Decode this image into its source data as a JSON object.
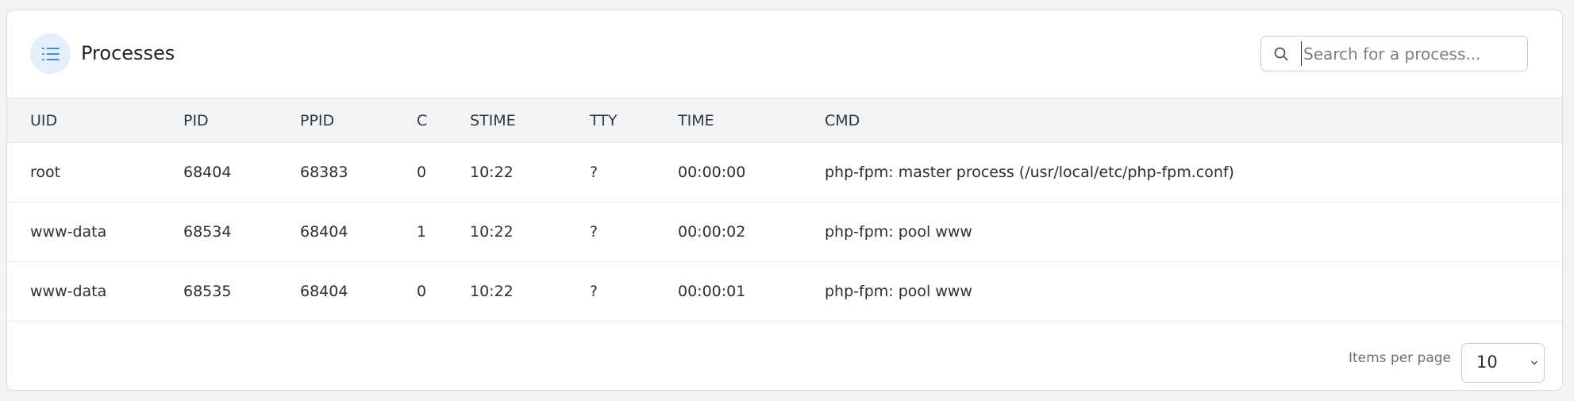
{
  "panel": {
    "title": "Processes",
    "title_icon": "list-icon",
    "accent_color": "#2f80c9"
  },
  "search": {
    "placeholder": "Search for a process...",
    "value": "",
    "icon": "search-icon"
  },
  "table": {
    "columns": [
      "UID",
      "PID",
      "PPID",
      "C",
      "STIME",
      "TTY",
      "TIME",
      "CMD"
    ],
    "rows": [
      [
        "root",
        "68404",
        "68383",
        "0",
        "10:22",
        "?",
        "00:00:00",
        "php-fpm: master process (/usr/local/etc/php-fpm.conf)"
      ],
      [
        "www-data",
        "68534",
        "68404",
        "1",
        "10:22",
        "?",
        "00:00:02",
        "php-fpm: pool www"
      ],
      [
        "www-data",
        "68535",
        "68404",
        "0",
        "10:22",
        "?",
        "00:00:01",
        "php-fpm: pool www"
      ]
    ]
  },
  "pagination": {
    "items_per_page_label": "Items per page",
    "items_per_page_value": "10",
    "dropdown_icon": "chevron-down-icon"
  }
}
